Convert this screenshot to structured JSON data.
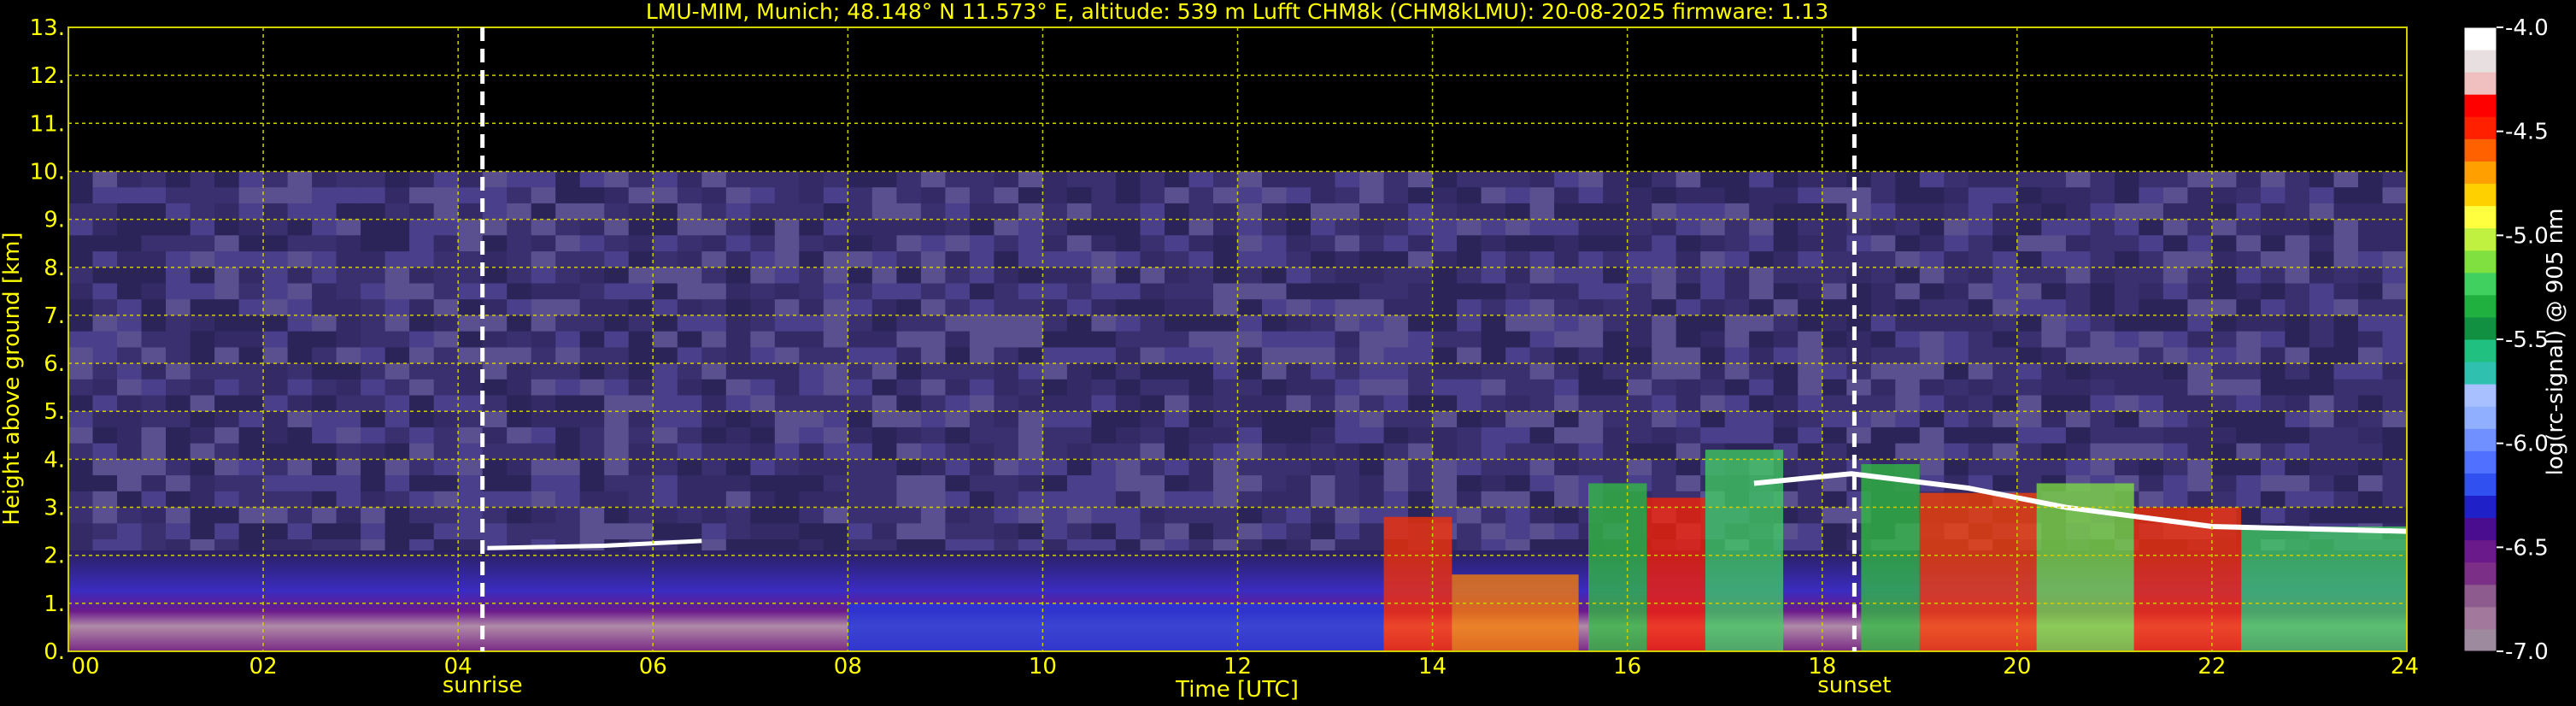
{
  "chart_data": {
    "type": "heatmap",
    "title": "LMU-MIM, Munich; 48.148° N 11.573° E, altitude: 539 m    Lufft CHM8k (CHM8kLMU): 20-08-2025    firmware: 1.13",
    "xlabel": "Time [UTC]",
    "ylabel": "Height above ground [km]",
    "xlim": [
      0,
      24
    ],
    "ylim": [
      0,
      13
    ],
    "x_ticks": [
      "00",
      "02",
      "04",
      "06",
      "08",
      "10",
      "12",
      "14",
      "16",
      "18",
      "20",
      "22",
      "24"
    ],
    "y_ticks": [
      "0.",
      "1.",
      "2.",
      "3.",
      "4.",
      "5.",
      "6.",
      "7.",
      "8.",
      "9.",
      "10.",
      "11.",
      "12.",
      "13."
    ],
    "grid": true,
    "markers": [
      {
        "label": "sunrise",
        "time": 4.25
      },
      {
        "label": "sunset",
        "time": 18.33
      }
    ],
    "colorbar": {
      "label": "log(rc-signal) @ 905 nm",
      "range": [
        -7.0,
        -4.0
      ],
      "ticks": [
        "-4.0",
        "-4.5",
        "-5.0",
        "-5.5",
        "-6.0",
        "-6.5",
        "-7.0"
      ],
      "colors": [
        "#9d8a9f",
        "#a2789d",
        "#8d5b8d",
        "#7b2f86",
        "#6a1a8a",
        "#4b0d8f",
        "#2020c8",
        "#3050f0",
        "#5070ff",
        "#7090ff",
        "#90b0ff",
        "#a8c0ff",
        "#30c0b0",
        "#20c080",
        "#109040",
        "#20b040",
        "#40d060",
        "#80e040",
        "#c0f040",
        "#ffff40",
        "#ffd000",
        "#ffa000",
        "#ff6000",
        "#ff2000",
        "#ff0000",
        "#f0c0c0",
        "#e8e0e0",
        "#ffffff"
      ]
    },
    "signal_top_km": 10.0
  }
}
